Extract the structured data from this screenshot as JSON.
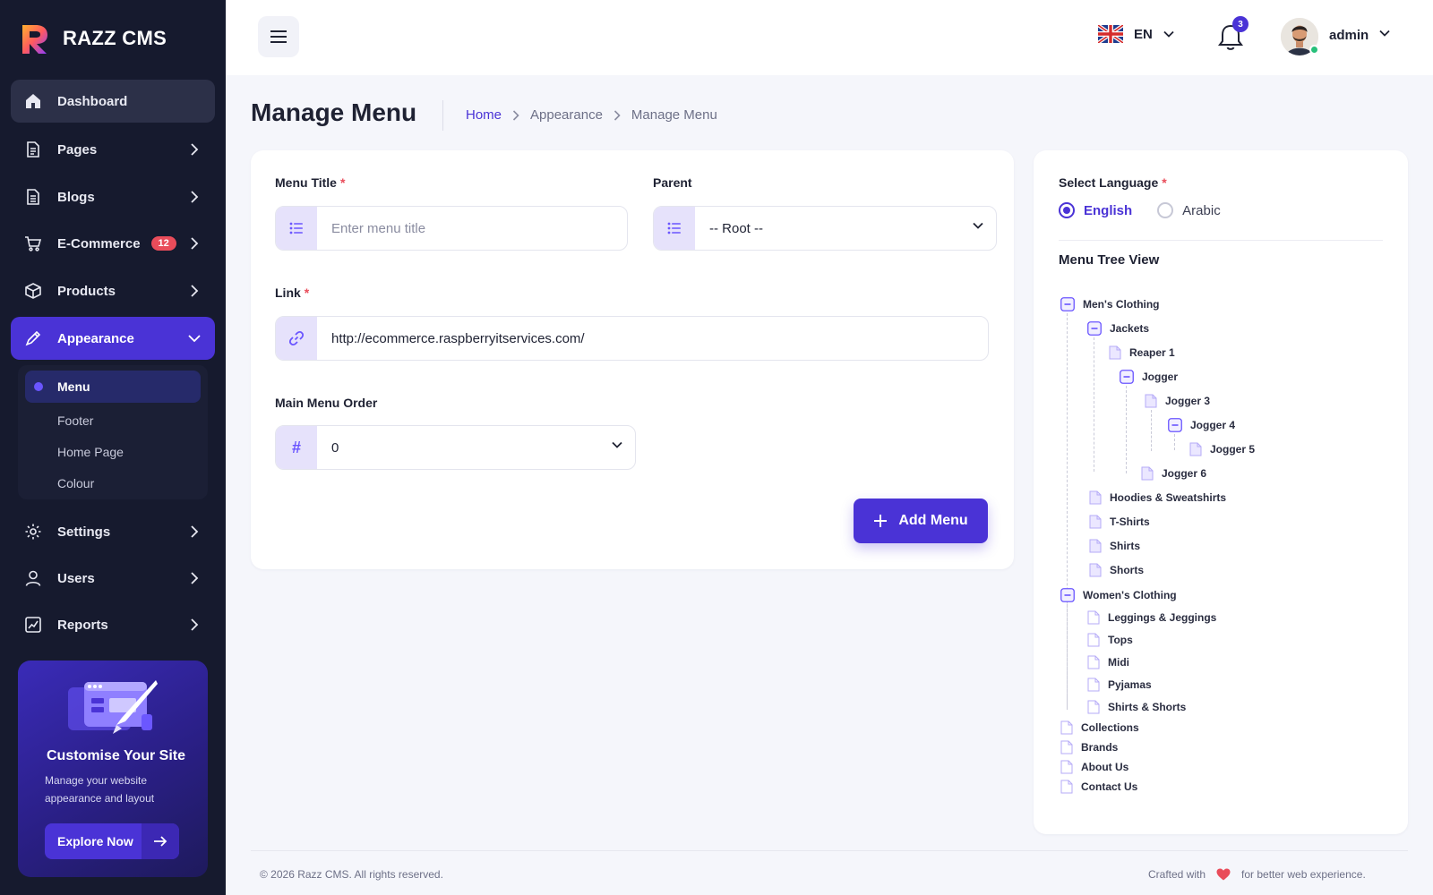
{
  "brand": {
    "name": "RAZZ CMS"
  },
  "sidebar": {
    "items": [
      {
        "label": "Dashboard",
        "icon": "home-icon"
      },
      {
        "label": "Pages",
        "icon": "page-icon"
      },
      {
        "label": "Blogs",
        "icon": "blog-icon"
      },
      {
        "label": "E-Commerce",
        "icon": "cart-icon",
        "badge": "12"
      },
      {
        "label": "Products",
        "icon": "box-icon"
      },
      {
        "label": "Appearance",
        "icon": "brush-icon"
      },
      {
        "label": "Settings",
        "icon": "gear-icon"
      },
      {
        "label": "Users",
        "icon": "user-icon"
      },
      {
        "label": "Reports",
        "icon": "chart-icon"
      }
    ],
    "submenu": [
      {
        "label": "Menu"
      },
      {
        "label": "Footer"
      },
      {
        "label": "Home Page"
      },
      {
        "label": "Colour"
      }
    ],
    "promo": {
      "title": "Customise Your Site",
      "desc": "Manage your website appearance and layout",
      "button": "Explore Now"
    }
  },
  "topbar": {
    "language": "EN",
    "notifications": "3",
    "user": "admin"
  },
  "page": {
    "title": "Manage Menu",
    "breadcrumb": [
      "Home",
      "Appearance",
      "Manage Menu"
    ]
  },
  "form": {
    "menu_title_label": "Menu Title",
    "menu_title_placeholder": "Enter menu title",
    "parent_label": "Parent",
    "parent_value": "-- Root --",
    "link_label": "Link",
    "link_value": "http://ecommerce.raspberryitservices.com/",
    "order_label": "Main Menu Order",
    "order_value": "0",
    "order_icon": "#",
    "required_mark": "*",
    "submit": "Add Menu"
  },
  "tree_panel": {
    "language_label": "Select Language",
    "languages": [
      "English",
      "Arabic"
    ],
    "selected_language": "English",
    "title": "Menu Tree View",
    "nodes": [
      "Men's Clothing",
      "Jackets",
      "Reaper 1",
      "Jogger",
      "Jogger 3",
      "Jogger 4",
      "Jogger 5",
      "Jogger 6",
      "Hoodies & Sweatshirts",
      "T-Shirts",
      "Shirts",
      "Shorts",
      "Women's Clothing",
      "Leggings & Jeggings",
      "Tops",
      "Midi",
      "Pyjamas",
      "Shirts & Shorts",
      "Collections",
      "Brands",
      "About Us",
      "Contact Us"
    ]
  },
  "footer": {
    "copyright": "© 2026 Razz CMS. All rights reserved.",
    "crafted_prefix": "Crafted with",
    "crafted_suffix": "for better web experience."
  },
  "colors": {
    "primary": "#4a33d6",
    "sidebar_bg": "#161a2e",
    "danger": "#e94c5a",
    "accent_light": "#e6e2fb"
  }
}
